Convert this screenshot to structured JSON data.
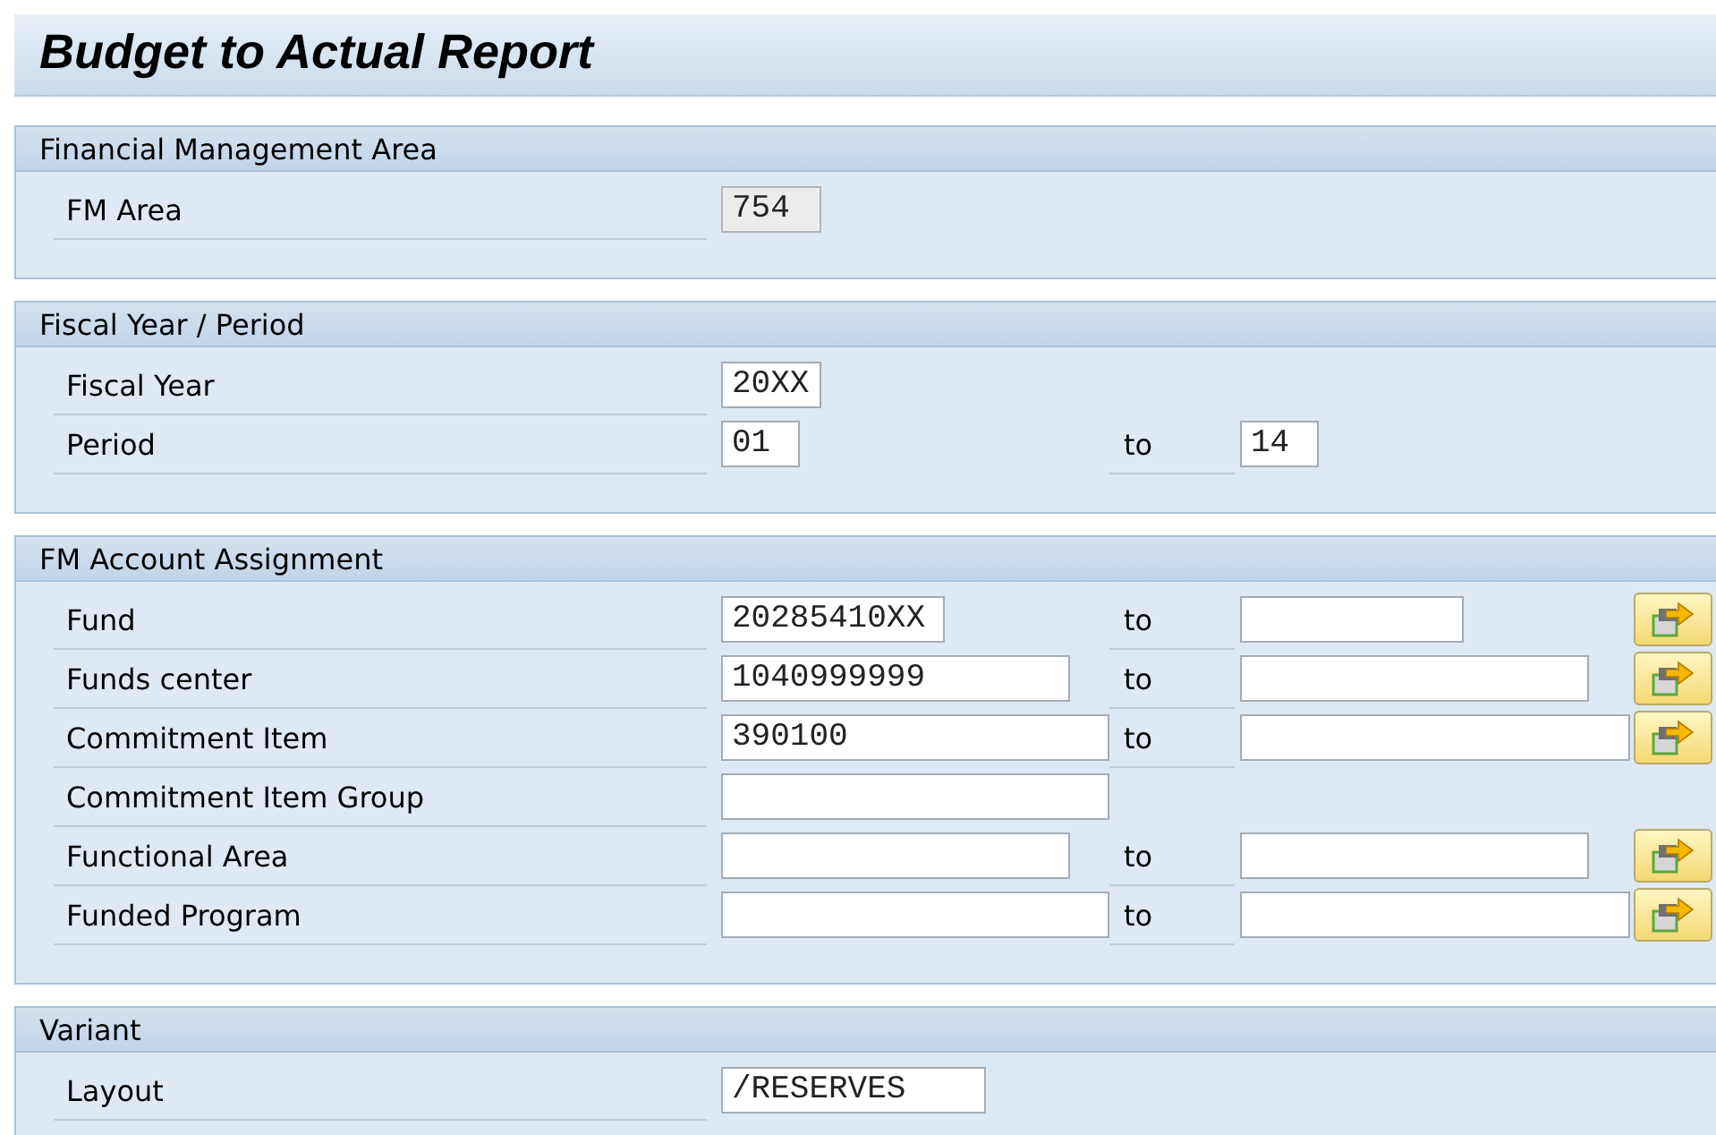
{
  "title": "Budget to Actual Report",
  "groups": [
    {
      "title": "Financial Management Area",
      "rows": [
        {
          "label": "FM Area",
          "low": {
            "value": "754",
            "read_only": true
          }
        }
      ]
    },
    {
      "title": "Fiscal Year / Period",
      "rows": [
        {
          "label": "Fiscal Year",
          "low": {
            "value": "20XX",
            "read_only": false
          }
        },
        {
          "label": "Period",
          "low": {
            "value": "01",
            "read_only": false
          },
          "to_label": "to",
          "high": {
            "value": "14",
            "read_only": false
          }
        }
      ]
    },
    {
      "title": "FM Account Assignment",
      "rows": [
        {
          "label": "Fund",
          "low": {
            "value": "20285410XX",
            "read_only": false
          },
          "to_label": "to",
          "high": {
            "read_only": false
          },
          "multiple_selection": true
        },
        {
          "label": "Funds center",
          "low": {
            "value": "1040999999",
            "read_only": false
          },
          "to_label": "to",
          "high": {
            "read_only": false
          },
          "multiple_selection": true
        },
        {
          "label": "Commitment Item",
          "low": {
            "value": "390100",
            "read_only": false
          },
          "to_label": "to",
          "high": {
            "read_only": false
          },
          "multiple_selection": true
        },
        {
          "label": "Commitment Item Group",
          "low": {
            "read_only": false
          },
          "multiple_selection": false
        },
        {
          "label": "Functional Area",
          "low": {
            "read_only": false
          },
          "to_label": "to",
          "high": {
            "read_only": false
          },
          "multiple_selection": true
        },
        {
          "label": "Funded Program",
          "low": {
            "read_only": false
          },
          "to_label": "to",
          "high": {
            "read_only": false
          },
          "multiple_selection": true
        }
      ]
    },
    {
      "title": "Variant",
      "rows": [
        {
          "label": "Layout",
          "low": {
            "value": "/RESERVES",
            "read_only": false
          }
        }
      ]
    }
  ]
}
